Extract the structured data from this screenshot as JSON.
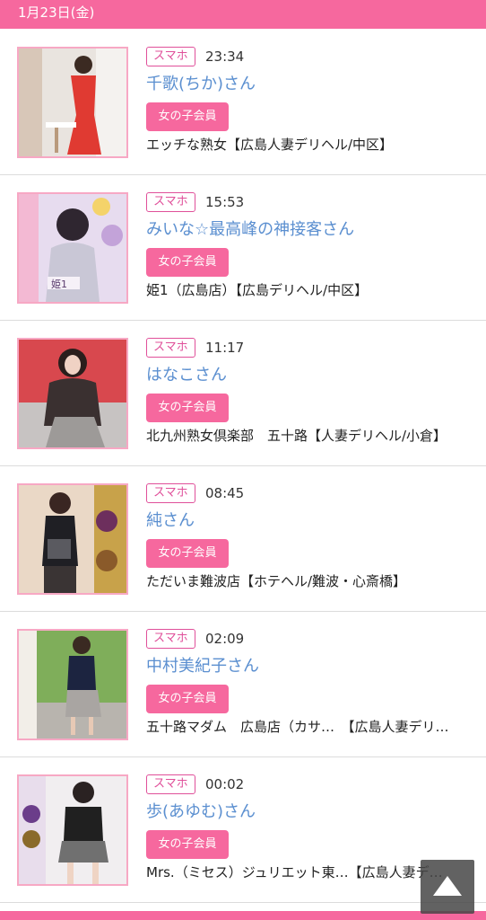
{
  "header": {
    "date": "1月23日(金)"
  },
  "items": [
    {
      "badge": "スマホ",
      "time": "23:34",
      "name": "千歌(ちか)さん",
      "member": "女の子会員",
      "shop": "エッチな熟女【広島人妻デリヘル/中区】",
      "thumb_text": ""
    },
    {
      "badge": "スマホ",
      "time": "15:53",
      "name": "みいな☆最高峰の神接客さん",
      "member": "女の子会員",
      "shop": "姫1（広島店）【広島デリヘル/中区】",
      "thumb_text": "姫1"
    },
    {
      "badge": "スマホ",
      "time": "11:17",
      "name": "はなこさん",
      "member": "女の子会員",
      "shop": "北九州熟女倶楽部　五十路【人妻デリヘル/小倉】",
      "thumb_text": ""
    },
    {
      "badge": "スマホ",
      "time": "08:45",
      "name": "純さん",
      "member": "女の子会員",
      "shop": "ただいま難波店【ホテヘル/難波・心斎橋】",
      "thumb_text": ""
    },
    {
      "badge": "スマホ",
      "time": "02:09",
      "name": "中村美紀子さん",
      "member": "女の子会員",
      "shop": "五十路マダム　広島店（カサ…　【広島人妻デリ…",
      "thumb_text": ""
    },
    {
      "badge": "スマホ",
      "time": "00:02",
      "name": "歩(あゆむ)さん",
      "member": "女の子会員",
      "shop": "Mrs.（ミセス）ジュリエット東…【広島人妻デ…",
      "thumb_text": ""
    }
  ],
  "scroll_top": {
    "icon": "arrow-up-icon"
  },
  "colors": {
    "accent": "#f6689e",
    "link": "#5b8fd0",
    "border": "#f7a8c4"
  }
}
